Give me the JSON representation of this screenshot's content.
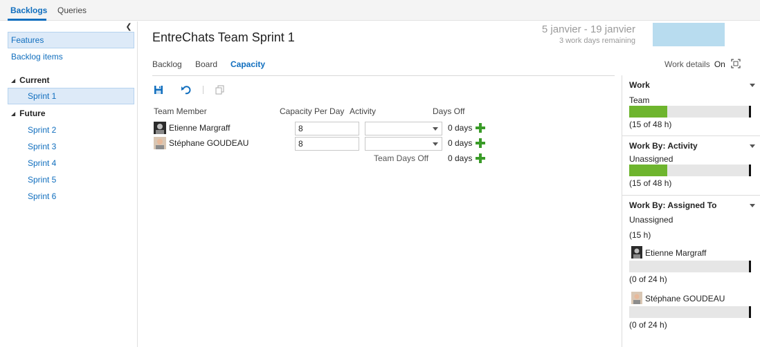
{
  "hub": {
    "tabs": [
      {
        "label": "Backlogs"
      },
      {
        "label": "Queries"
      }
    ]
  },
  "sidebar": {
    "items": [
      {
        "label": "Features"
      },
      {
        "label": "Backlog items"
      }
    ],
    "groups": [
      {
        "label": "Current"
      },
      {
        "label": "Future"
      }
    ],
    "sprints": [
      {
        "label": "Sprint 1"
      },
      {
        "label": "Sprint 2"
      },
      {
        "label": "Sprint 3"
      },
      {
        "label": "Sprint 4"
      },
      {
        "label": "Sprint 5"
      },
      {
        "label": "Sprint 6"
      }
    ]
  },
  "header": {
    "title": "EntreChats Team Sprint 1",
    "date_range": "5 janvier - 19 janvier",
    "days_remaining": "3 work days remaining"
  },
  "pivots": [
    {
      "label": "Backlog"
    },
    {
      "label": "Board"
    },
    {
      "label": "Capacity"
    }
  ],
  "work_details": {
    "label": "Work details",
    "state": "On"
  },
  "toolbar": {
    "icons": [
      "save-icon",
      "undo-icon",
      "copy-icon"
    ]
  },
  "table": {
    "headers": [
      "Team Member",
      "Capacity Per Day",
      "Activity",
      "Days Off"
    ],
    "rows": [
      {
        "member": "Etienne Margraff",
        "capacity": "8",
        "activity": "",
        "days_off": "0 days"
      },
      {
        "member": "Stéphane GOUDEAU",
        "capacity": "8",
        "activity": "",
        "days_off": "0 days"
      }
    ],
    "team_days_off_label": "Team Days Off",
    "team_days_off_value": "0 days"
  },
  "right_panel": {
    "work": {
      "title": "Work",
      "label": "Team",
      "value": "(15 of 48 h)",
      "fill_fraction": 0.3125
    },
    "activity": {
      "title": "Work By: Activity",
      "label": "Unassigned",
      "value": "(15 of 48 h)",
      "fill_fraction": 0.3125
    },
    "assigned": {
      "title": "Work By: Assigned To",
      "unassigned_label": "Unassigned",
      "unassigned_value": "(15 h)",
      "people": [
        {
          "name": "Etienne Margraff",
          "value": "(0 of 24 h)",
          "fill_fraction": 0
        },
        {
          "name": "Stéphane GOUDEAU",
          "value": "(0 of 24 h)",
          "fill_fraction": 0
        }
      ]
    }
  },
  "colors": {
    "accent": "#106ebe",
    "bar_fill": "#6eb52e",
    "bar_track": "#e6e6e6",
    "plus": "#3a9b28",
    "burndown": "#b8dcef"
  }
}
